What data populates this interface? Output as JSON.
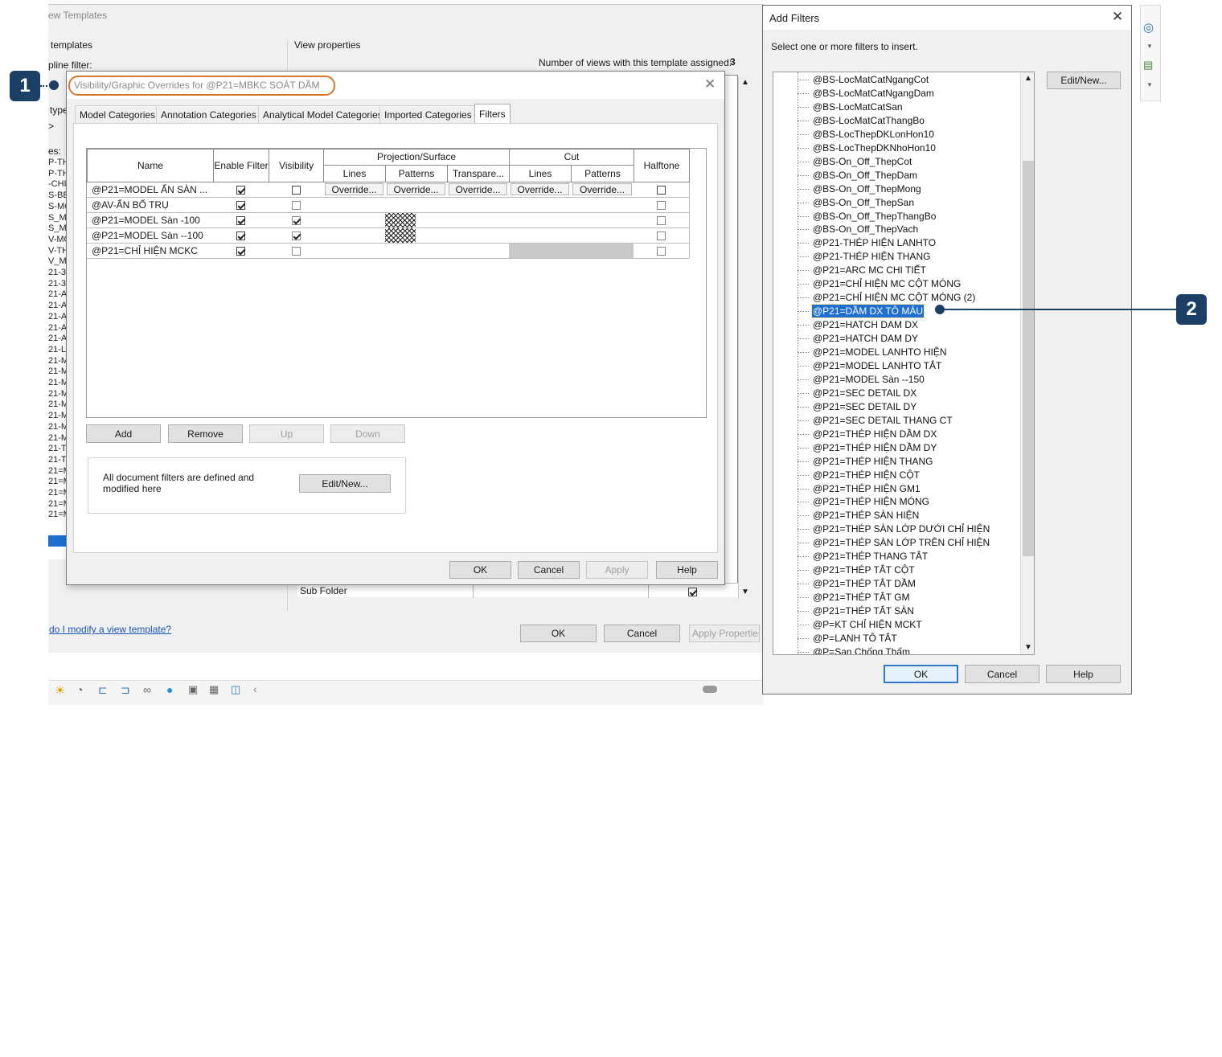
{
  "bg_window": {
    "title_partial": "ew Templates",
    "templates_label": "templates",
    "discipline_filter_label": "pline filter:",
    "type_label": "type",
    "arrow": ">",
    "names_label": "es:",
    "view_properties_label": "View properties",
    "views_assigned_label": "Number of views with this template assigned:",
    "views_assigned_count": "3",
    "sub_folder_label": "Sub Folder",
    "help_link": "do I modify a view template?",
    "ok": "OK",
    "cancel": "Cancel",
    "apply_properties": "Apply Properties",
    "left_list_items": [
      "P-TH",
      "P-TH",
      "-CHI",
      "S-BE",
      "S-MO",
      "S_ME",
      "S_MO",
      "V-MO",
      "V-TH",
      "V_ME",
      "21-3",
      "21-3",
      "21-A",
      "21-A",
      "21-A",
      "21-A",
      "21-A",
      "21-L",
      "21-M",
      "21-M",
      "21-M",
      "21-M",
      "21-M",
      "21-M",
      "21-M",
      "21-M",
      "21-T",
      "21-T",
      "21=M",
      "21=M",
      "21=M",
      "21=M",
      "21=M"
    ]
  },
  "vg_dialog": {
    "title": "Visibility/Graphic Overrides for @P21=MBKC SOÁT DẦM",
    "tabs": [
      "Model Categories",
      "Annotation Categories",
      "Analytical Model Categories",
      "Imported Categories",
      "Filters"
    ],
    "active_tab": "Filters",
    "headers": {
      "name": "Name",
      "enable_filter": "Enable Filter",
      "visibility": "Visibility",
      "projection_surface": "Projection/Surface",
      "cut": "Cut",
      "halftone": "Halftone",
      "lines": "Lines",
      "patterns": "Patterns",
      "transparency": "Transpare...",
      "cut_lines": "Lines",
      "cut_patterns": "Patterns"
    },
    "override_label": "Override...",
    "rows": [
      {
        "name": "@P21=MODEL ẨN SÀN ...",
        "enable": true,
        "visible": false
      },
      {
        "name": "@AV-ẨN BỔ TRỤ",
        "enable": true,
        "visible": false
      },
      {
        "name": "@P21=MODEL Sàn -100",
        "enable": true,
        "visible": true
      },
      {
        "name": "@P21=MODEL Sàn --100",
        "enable": true,
        "visible": true
      },
      {
        "name": "@P21=CHỈ HIỆN MCKC",
        "enable": true,
        "visible": false
      }
    ],
    "add": "Add",
    "remove": "Remove",
    "up": "Up",
    "down": "Down",
    "info_text": "All document filters are defined and modified here",
    "edit_new": "Edit/New...",
    "ok": "OK",
    "cancel": "Cancel",
    "apply": "Apply",
    "help": "Help"
  },
  "add_filters": {
    "title": "Add Filters",
    "instruction": "Select one or more filters to insert.",
    "edit_new": "Edit/New...",
    "selected": "@P21=DẦM DX TÔ MÀU",
    "items": [
      "@BS-LocMatCatNgangCot",
      "@BS-LocMatCatNgangDam",
      "@BS-LocMatCatSan",
      "@BS-LocMatCatThangBo",
      "@BS-LocThepDKLonHon10",
      "@BS-LocThepDKNhoHon10",
      "@BS-On_Off_ThepCot",
      "@BS-On_Off_ThepDam",
      "@BS-On_Off_ThepMong",
      "@BS-On_Off_ThepSan",
      "@BS-On_Off_ThepThangBo",
      "@BS-On_Off_ThepVach",
      "@P21-THÉP HIỆN LANHTO",
      "@P21-THÉP HIỆN THANG",
      "@P21=ARC MC CHI TIẾT",
      "@P21=CHỈ HIỆN MC CỘT MÓNG",
      "@P21=CHỈ HIỆN MC CỘT MÓNG (2)",
      "@P21=DẦM DX TÔ MÀU",
      "@P21=HATCH DAM DX",
      "@P21=HATCH DAM DY",
      "@P21=MODEL LANHTO HIỆN",
      "@P21=MODEL LANHTO TẮT",
      "@P21=MODEL Sàn --150",
      "@P21=SEC DETAIL DX",
      "@P21=SEC DETAIL DY",
      "@P21=SEC DETAIL THANG CT",
      "@P21=THÉP  HIỆN  DẦM DX",
      "@P21=THÉP  HIỆN  DẦM DY",
      "@P21=THÉP  HIỆN  THANG",
      "@P21=THÉP HIỆN CỘT",
      "@P21=THÉP HIỆN GM1",
      "@P21=THÉP HIỆN MÓNG",
      "@P21=THÉP SÀN HIỆN",
      "@P21=THÉP SÀN LỚP DƯỚI CHỈ HIỆN",
      "@P21=THÉP SÀN LỚP TRÊN CHỈ HIỆN",
      "@P21=THÉP THANG TẮT",
      "@P21=THÉP  TẮT  CỘT",
      "@P21=THÉP  TẮT  DẦM",
      "@P21=THÉP  TẮT GM",
      "@P21=THÉP  TẮT SÀN",
      "@P=KT CHỈ HIỆN MCKT",
      "@P=LANH TÔ TẮT",
      "@P=San Chống Thấm"
    ],
    "ok": "OK",
    "cancel": "Cancel",
    "help": "Help"
  },
  "callouts": {
    "one": "1",
    "two": "2"
  },
  "colors": {
    "accent": "#1c3f66",
    "highlight": "#1f6fd1",
    "title_outline": "#d9772b"
  }
}
